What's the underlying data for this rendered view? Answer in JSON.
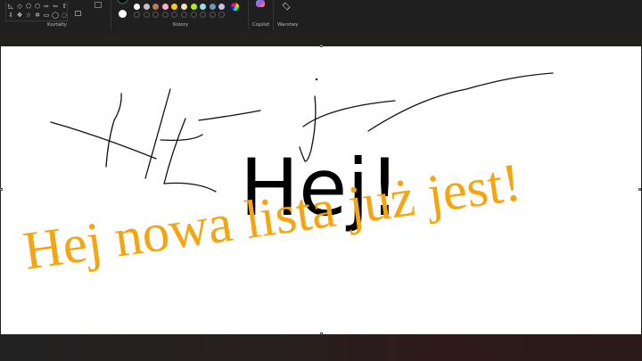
{
  "ribbon": {
    "groups": [
      {
        "label": "Kształty"
      },
      {
        "label": "Kolory"
      },
      {
        "label": "Copilot"
      },
      {
        "label": "Warstwy"
      }
    ],
    "shape_glyphs": [
      "◺",
      "◇",
      "⬠",
      "⬡",
      "⇨",
      "⇦",
      "⇧",
      "⇩",
      "✥",
      "☆",
      "✡",
      "▭",
      "◯",
      "◌"
    ],
    "palette": [
      "#ffffff",
      "#c3c3c3",
      "#b97a57",
      "#ffaec9",
      "#ffc90e",
      "#efe4b0",
      "#b5e61d",
      "#99d9ea",
      "#7092be",
      "#c8bfe7"
    ],
    "primary_color": "#000000",
    "secondary_color": "#ffffff"
  },
  "canvas": {
    "black_text": "Hej!",
    "orange_text": "Hej nowa lista już jest!",
    "orange_color": "#f5a50f"
  }
}
